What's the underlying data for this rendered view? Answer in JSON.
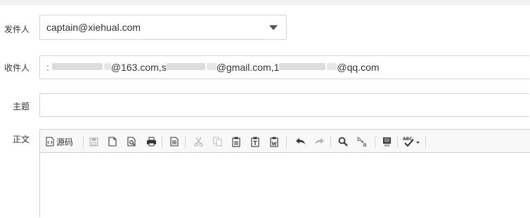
{
  "form": {
    "sender_label": "发件人",
    "sender_value": "captain@xiehual.com",
    "recipient_label": "收件人",
    "recipient_parts": [
      "@163.com,s",
      "@gmail.com,1",
      "@qq.com"
    ],
    "subject_label": "主题",
    "subject_value": "",
    "body_label": "正文"
  },
  "toolbar": {
    "source_label": "源码",
    "icons": [
      "source-icon",
      "save-icon",
      "new-page-icon",
      "preview-icon",
      "print-icon",
      "templates-icon",
      "cut-icon",
      "copy-icon",
      "paste-icon",
      "paste-text-icon",
      "paste-word-icon",
      "undo-icon",
      "redo-icon",
      "find-icon",
      "replace-icon",
      "select-all-icon",
      "spellcheck-icon"
    ]
  },
  "colors": {
    "border": "#d4d4d4",
    "toolbar_bg": "#f8f8f8",
    "text": "#333333",
    "icon": "#333333",
    "disabled_icon": "#b5b5b5"
  }
}
